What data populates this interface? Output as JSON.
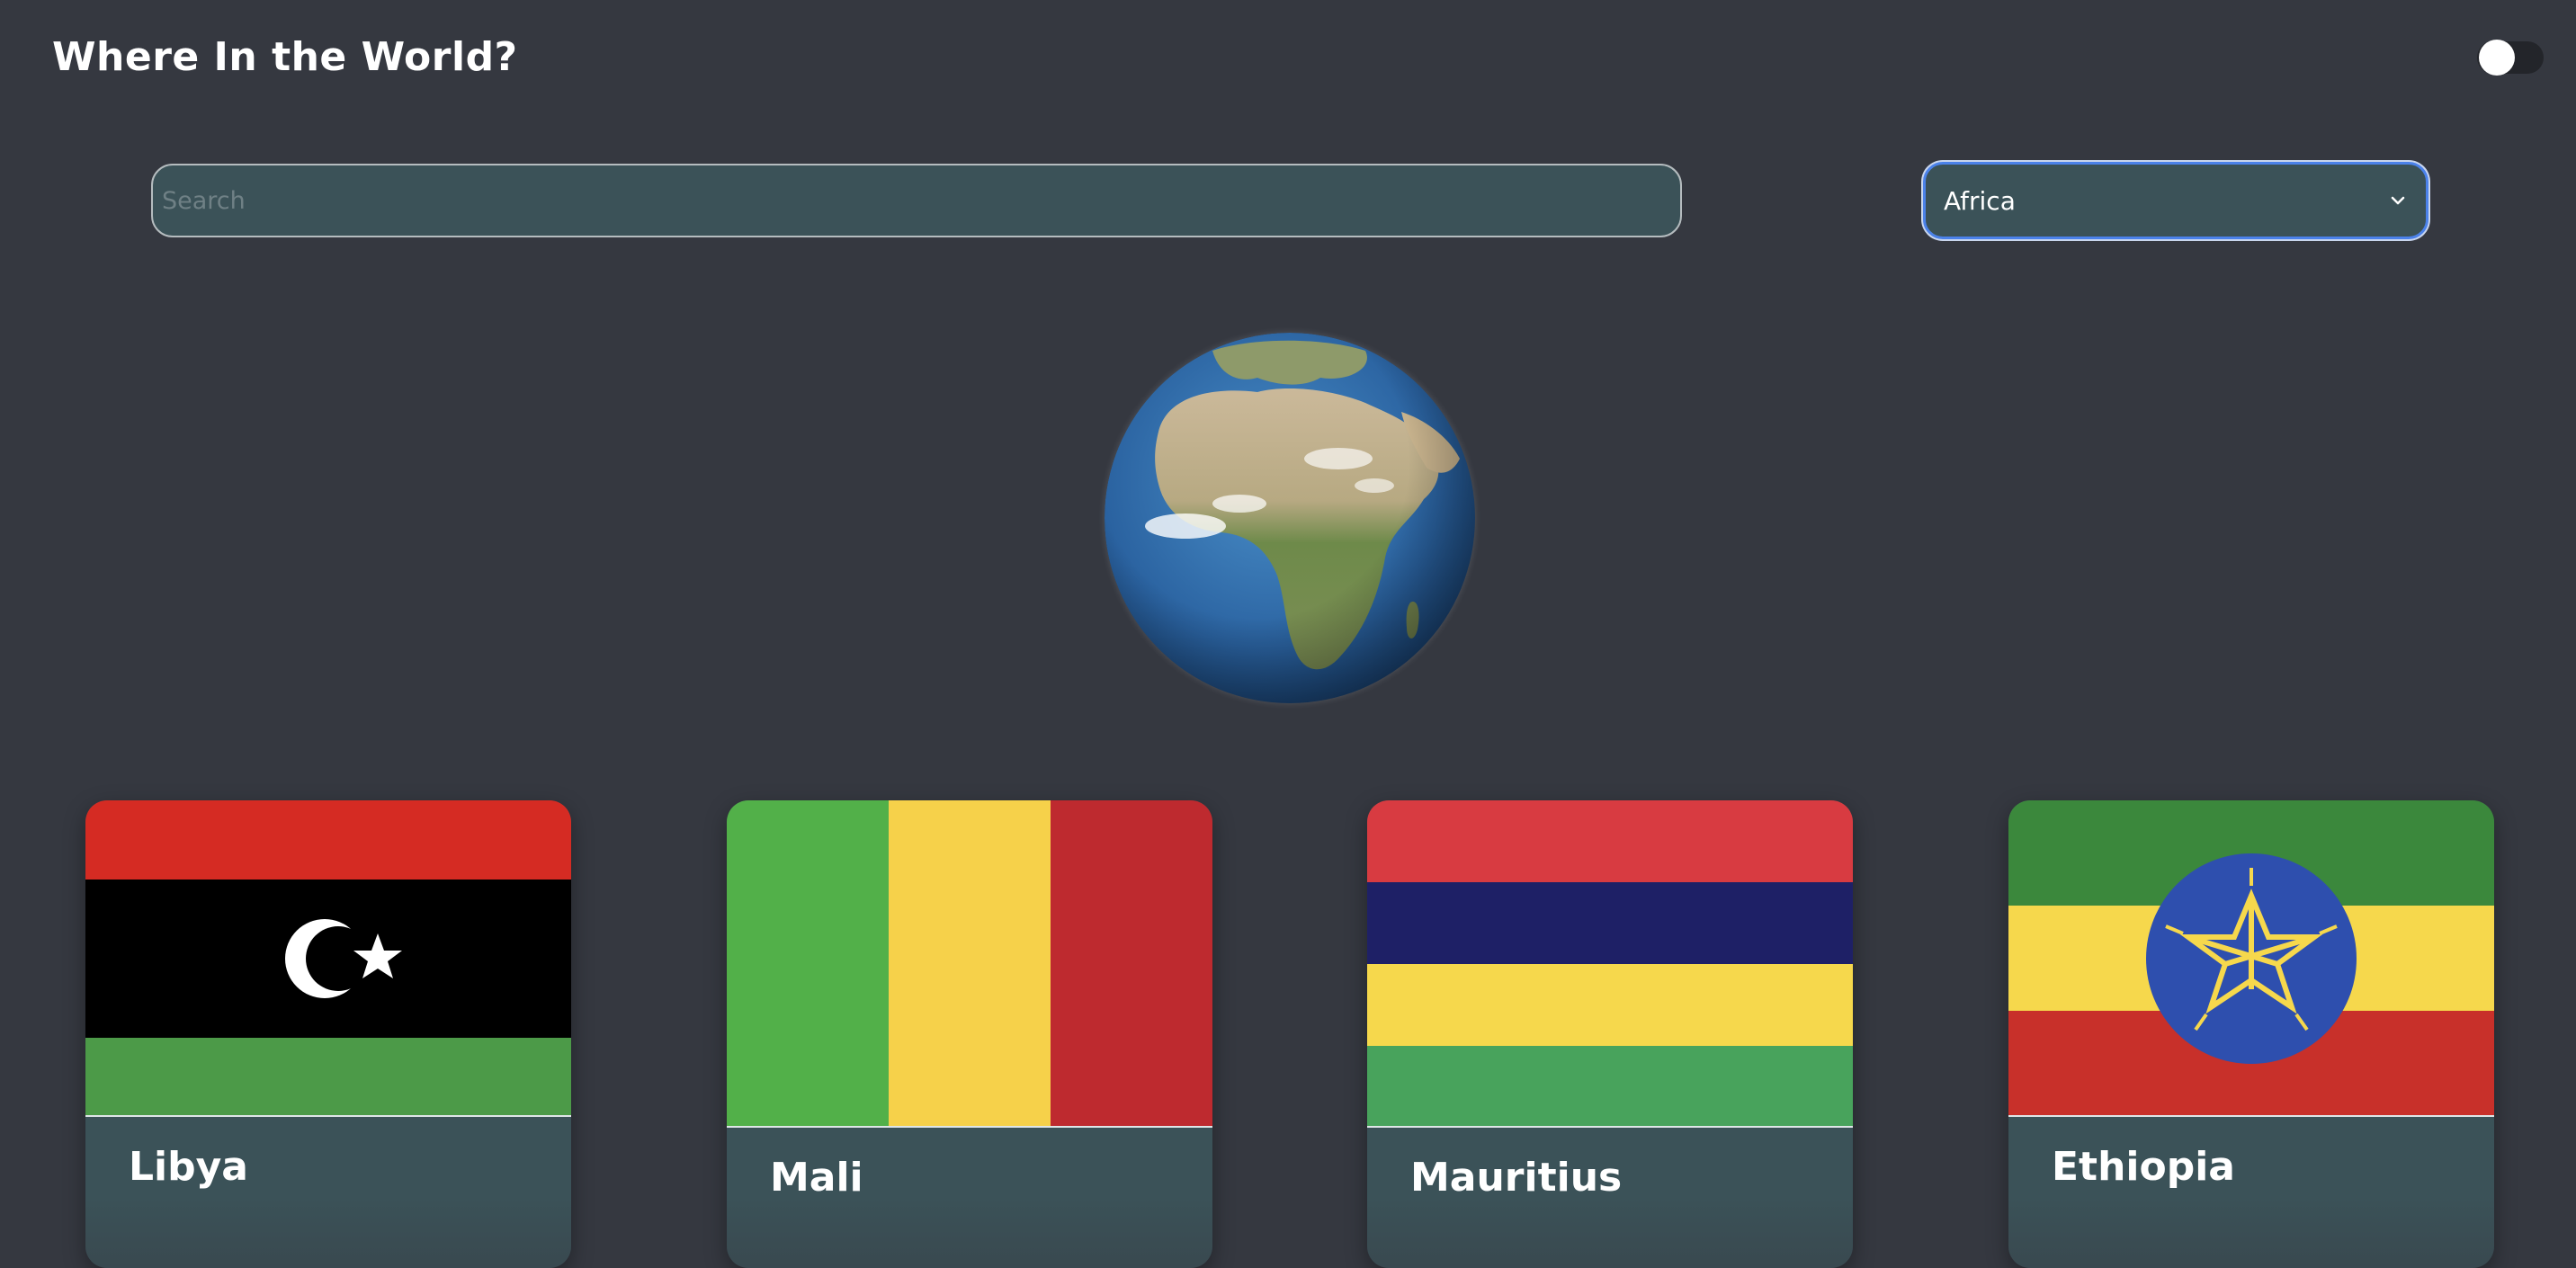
{
  "header": {
    "title": "Where In the World?"
  },
  "search": {
    "placeholder": "Search",
    "value": ""
  },
  "region_filter": {
    "selected": "Africa"
  },
  "theme_toggle": {
    "state": "off"
  },
  "colors": {
    "background": "#353840",
    "card": "#3b5258",
    "select_focus": "#4b82ea"
  },
  "countries": [
    {
      "name": "Libya"
    },
    {
      "name": "Mali"
    },
    {
      "name": "Mauritius"
    },
    {
      "name": "Ethiopia"
    }
  ]
}
